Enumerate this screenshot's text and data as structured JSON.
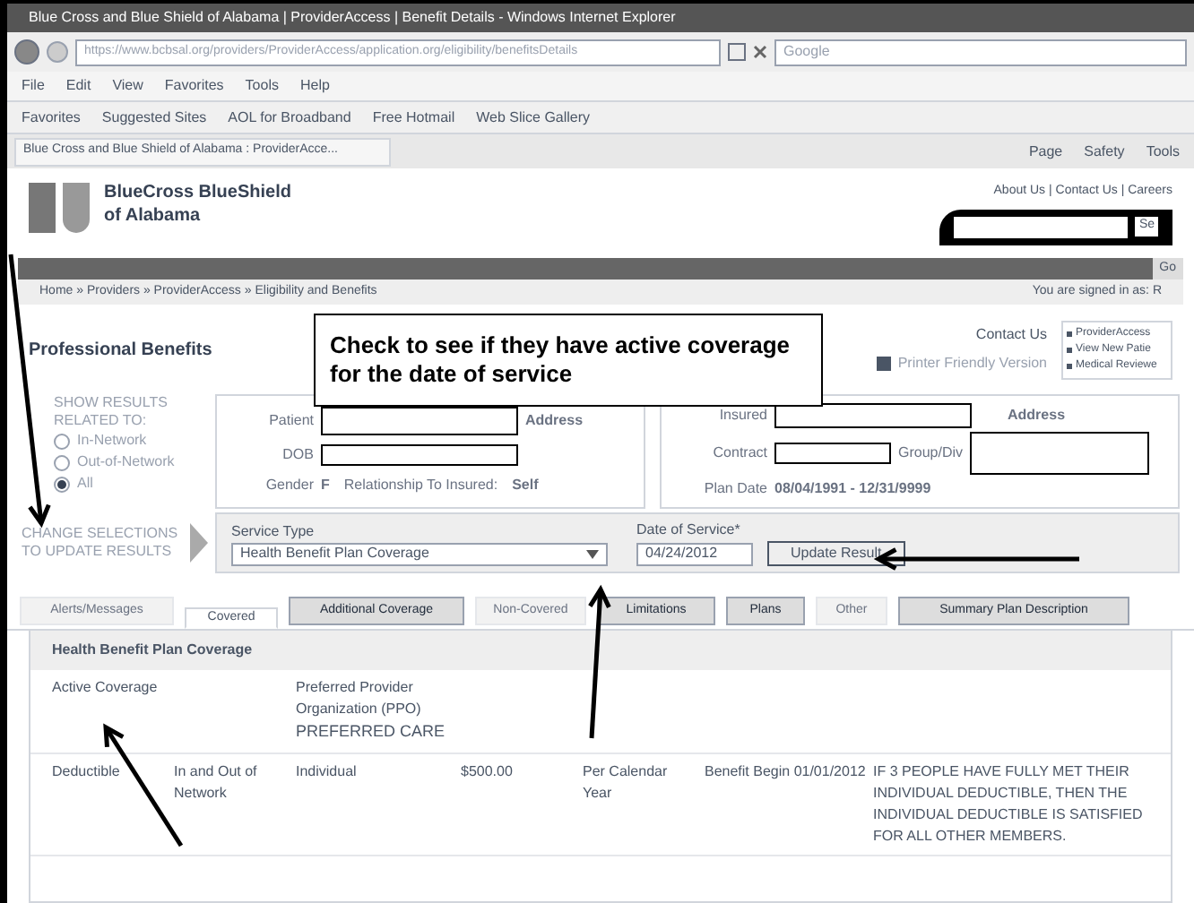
{
  "window": {
    "title": "Blue Cross and Blue Shield of Alabama | ProviderAccess | Benefit Details - Windows Internet Explorer"
  },
  "address_bar": {
    "url": "https://www.bcbsal.org/providers/ProviderAccess/application.org/eligibility/benefitsDetails",
    "search_placeholder": "Google"
  },
  "menu": [
    "File",
    "Edit",
    "View",
    "Favorites",
    "Tools",
    "Help"
  ],
  "favorites_bar": [
    "Favorites",
    "Suggested Sites",
    "AOL for Broadband",
    "Free Hotmail",
    "Web Slice Gallery"
  ],
  "browser_tab": {
    "label": "Blue Cross and Blue Shield of Alabama : ProviderAcce..."
  },
  "command_bar": [
    "Page",
    "Safety",
    "Tools"
  ],
  "site": {
    "logo_line1": "BlueCross BlueShield",
    "logo_line2": "of Alabama",
    "top_links": "About Us | Contact Us | Careers",
    "go_label": "Go",
    "search_button": "Se"
  },
  "breadcrumb": "Home » Providers » ProviderAccess » Eligibility and Benefits",
  "signed_in": "You are signed in as: R",
  "heading": "Professional Benefits",
  "contact_us": "Contact Us",
  "printer_friendly": "Printer Friendly Version",
  "side_links": [
    "ProviderAccess",
    "View New Patie",
    "Medical Reviewe"
  ],
  "callout": "Check to see if they have active coverage for the date of service",
  "show_results": {
    "label": "SHOW RESULTS RELATED TO:",
    "options": [
      {
        "label": "In-Network",
        "selected": false
      },
      {
        "label": "Out-of-Network",
        "selected": false
      },
      {
        "label": "All",
        "selected": true
      }
    ]
  },
  "patient": {
    "patient_label": "Patient",
    "dob_label": "DOB",
    "gender_label": "Gender",
    "gender": "F",
    "relationship_label": "Relationship To Insured:",
    "relationship": "Self",
    "address_label": "Address"
  },
  "insured": {
    "insured_label": "Insured",
    "contract_label": "Contract",
    "group_label": "Group/Div",
    "plan_date_label": "Plan Date",
    "plan_date": "08/04/1991 - 12/31/9999",
    "address_label": "Address"
  },
  "change_selections": "CHANGE SELECTIONS TO UPDATE RESULTS",
  "service_type": {
    "label": "Service Type",
    "value": "Health Benefit Plan Coverage"
  },
  "date_of_service": {
    "label": "Date of Service*",
    "value": "04/24/2012"
  },
  "update_button": "Update Result",
  "tabs": [
    {
      "label": "Alerts/Messages",
      "selected": false,
      "disabled": true
    },
    {
      "label": "Covered",
      "selected": true,
      "disabled": false
    },
    {
      "label": "Additional Coverage",
      "selected": false,
      "disabled": false
    },
    {
      "label": "Non-Covered",
      "selected": false,
      "disabled": true
    },
    {
      "label": "Limitations",
      "selected": false,
      "disabled": false
    },
    {
      "label": "Plans",
      "selected": false,
      "disabled": false
    },
    {
      "label": "Other",
      "selected": false,
      "disabled": true
    },
    {
      "label": "Summary Plan Description",
      "selected": false,
      "disabled": false
    }
  ],
  "table": {
    "title": "Health Benefit Plan Coverage",
    "rows": [
      {
        "cells": [
          "Active Coverage",
          "",
          "Preferred Provider Organization (PPO)",
          "",
          "",
          "",
          ""
        ],
        "extra": "PREFERRED CARE"
      },
      {
        "cells": [
          "Deductible",
          "In and Out of Network",
          "Individual",
          "$500.00",
          "Per Calendar Year",
          "Benefit Begin 01/01/2012",
          "IF 3 PEOPLE HAVE FULLY MET THEIR INDIVIDUAL DEDUCTIBLE, THEN THE INDIVIDUAL DEDUCTIBLE IS SATISFIED FOR ALL OTHER MEMBERS."
        ]
      }
    ]
  }
}
